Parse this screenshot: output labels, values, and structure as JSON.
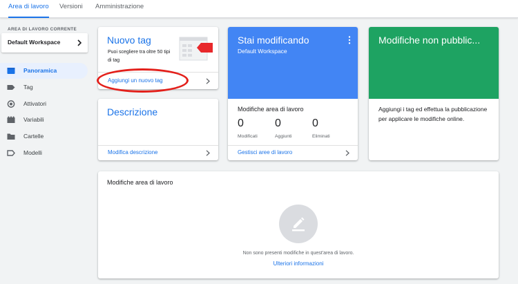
{
  "tabs": [
    {
      "label": "Area di lavoro",
      "active": true
    },
    {
      "label": "Versioni",
      "active": false
    },
    {
      "label": "Amministrazione",
      "active": false
    }
  ],
  "sidebar": {
    "workspace_caption": "AREA DI LAVORO CORRENTE",
    "workspace_name": "Default Workspace",
    "items": [
      {
        "label": "Panoramica",
        "icon": "overview-icon",
        "active": true
      },
      {
        "label": "Tag",
        "icon": "tag-icon"
      },
      {
        "label": "Attivatori",
        "icon": "trigger-icon"
      },
      {
        "label": "Variabili",
        "icon": "variables-icon"
      },
      {
        "label": "Cartelle",
        "icon": "folder-icon"
      },
      {
        "label": "Modelli",
        "icon": "template-icon"
      }
    ]
  },
  "new_tag_card": {
    "title": "Nuovo tag",
    "description": "Puoi scegliere tra oltre 50 tipi di tag",
    "link": "Aggiungi un nuovo tag"
  },
  "description_card": {
    "title": "Descrizione",
    "link": "Modifica descrizione"
  },
  "editing_card": {
    "title": "Stai modificando",
    "subtitle": "Default Workspace",
    "section_title": "Modifiche area di lavoro",
    "stats": [
      {
        "value": "0",
        "label": "Modificati"
      },
      {
        "value": "0",
        "label": "Aggiunti"
      },
      {
        "value": "0",
        "label": "Eliminati"
      }
    ],
    "link": "Gestisci aree di lavoro"
  },
  "unpublished_card": {
    "title": "Modifiche non pubblic...",
    "body": "Aggiungi i tag ed effettua la pubblicazione per applicare le modifiche online."
  },
  "changes_card": {
    "title": "Modifiche area di lavoro",
    "empty_message": "Non sono presenti modifiche in quest'area di lavoro.",
    "link": "Ulteriori informazioni"
  },
  "colors": {
    "accent": "#1a73e8",
    "blue_header": "#4285f4",
    "green_header": "#1ea362",
    "highlight": "#e3201b"
  }
}
